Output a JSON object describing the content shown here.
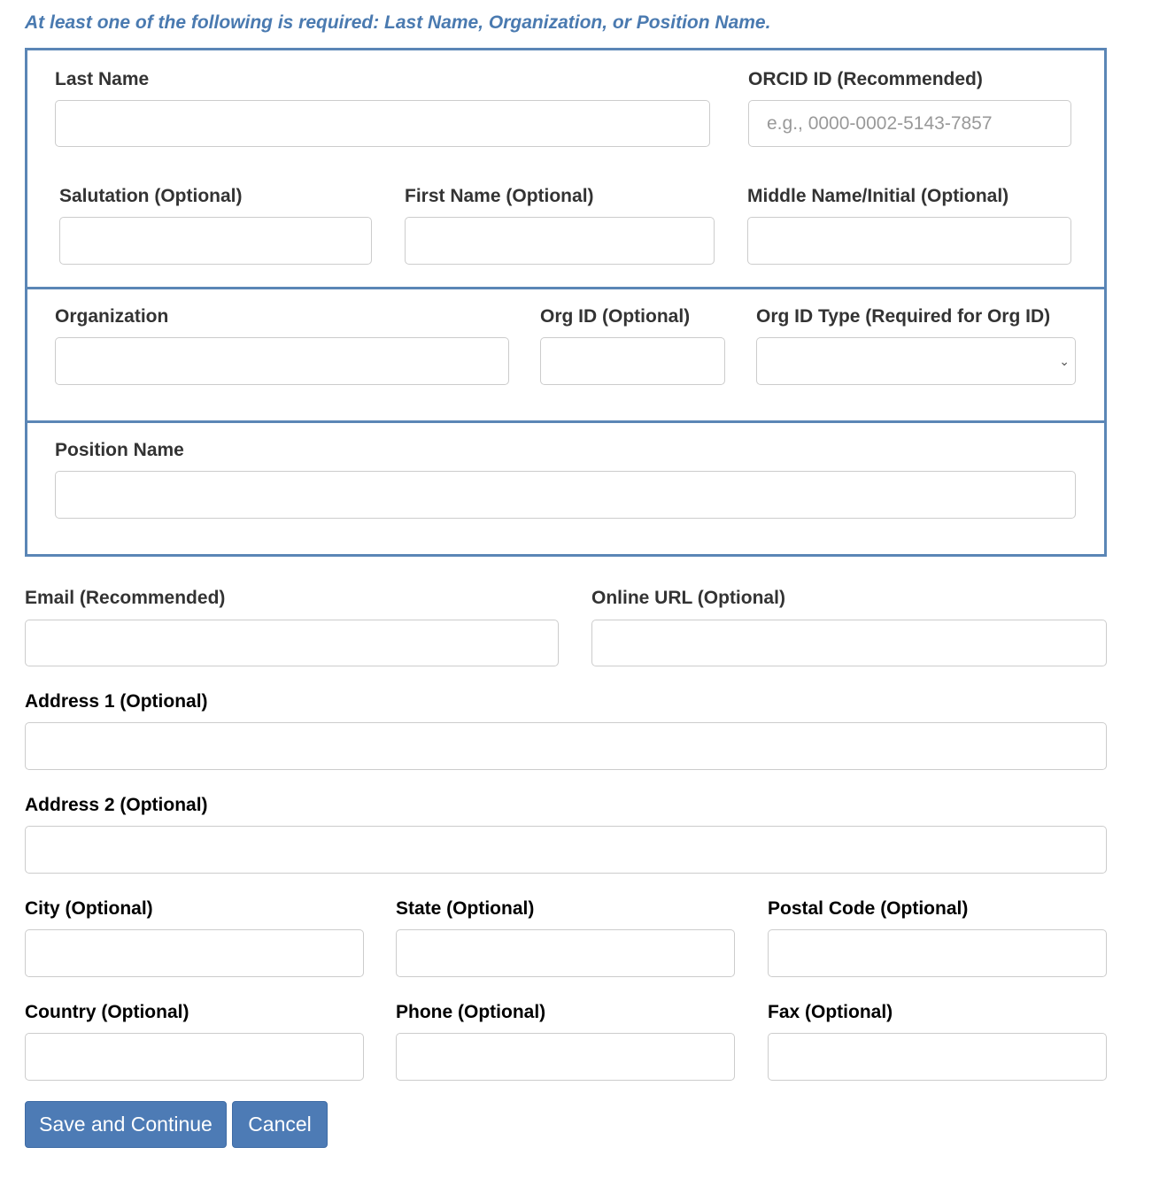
{
  "notice": "At least one of the following is required: Last Name, Organization, or Position Name.",
  "name_section": {
    "last_name": {
      "label": "Last Name",
      "value": ""
    },
    "orcid": {
      "label": "ORCID ID (Recommended)",
      "placeholder": "e.g., 0000-0002-5143-7857",
      "value": ""
    },
    "salutation": {
      "label": "Salutation (Optional)",
      "value": ""
    },
    "first_name": {
      "label": "First Name (Optional)",
      "value": ""
    },
    "middle_name": {
      "label": "Middle Name/Initial (Optional)",
      "value": ""
    }
  },
  "org_section": {
    "organization": {
      "label": "Organization",
      "value": ""
    },
    "org_id": {
      "label": "Org ID (Optional)",
      "value": ""
    },
    "org_id_type": {
      "label": "Org ID Type (Required for Org ID)",
      "selected": ""
    }
  },
  "position_section": {
    "position_name": {
      "label": "Position Name",
      "value": ""
    }
  },
  "contact": {
    "email": {
      "label": "Email (Recommended)",
      "value": ""
    },
    "online_url": {
      "label": "Online URL (Optional)",
      "value": ""
    },
    "address1": {
      "label": "Address 1 (Optional)",
      "value": ""
    },
    "address2": {
      "label": "Address 2 (Optional)",
      "value": ""
    },
    "city": {
      "label": "City (Optional)",
      "value": ""
    },
    "state": {
      "label": "State (Optional)",
      "value": ""
    },
    "postal_code": {
      "label": "Postal Code (Optional)",
      "value": ""
    },
    "country": {
      "label": "Country (Optional)",
      "value": ""
    },
    "phone": {
      "label": "Phone (Optional)",
      "value": ""
    },
    "fax": {
      "label": "Fax (Optional)",
      "value": ""
    }
  },
  "buttons": {
    "save_label": "Save and Continue",
    "cancel_label": "Cancel"
  },
  "colors": {
    "accent": "#4d7bb5",
    "notice_text": "#4a7ab0",
    "box_border": "#5b86b6"
  }
}
